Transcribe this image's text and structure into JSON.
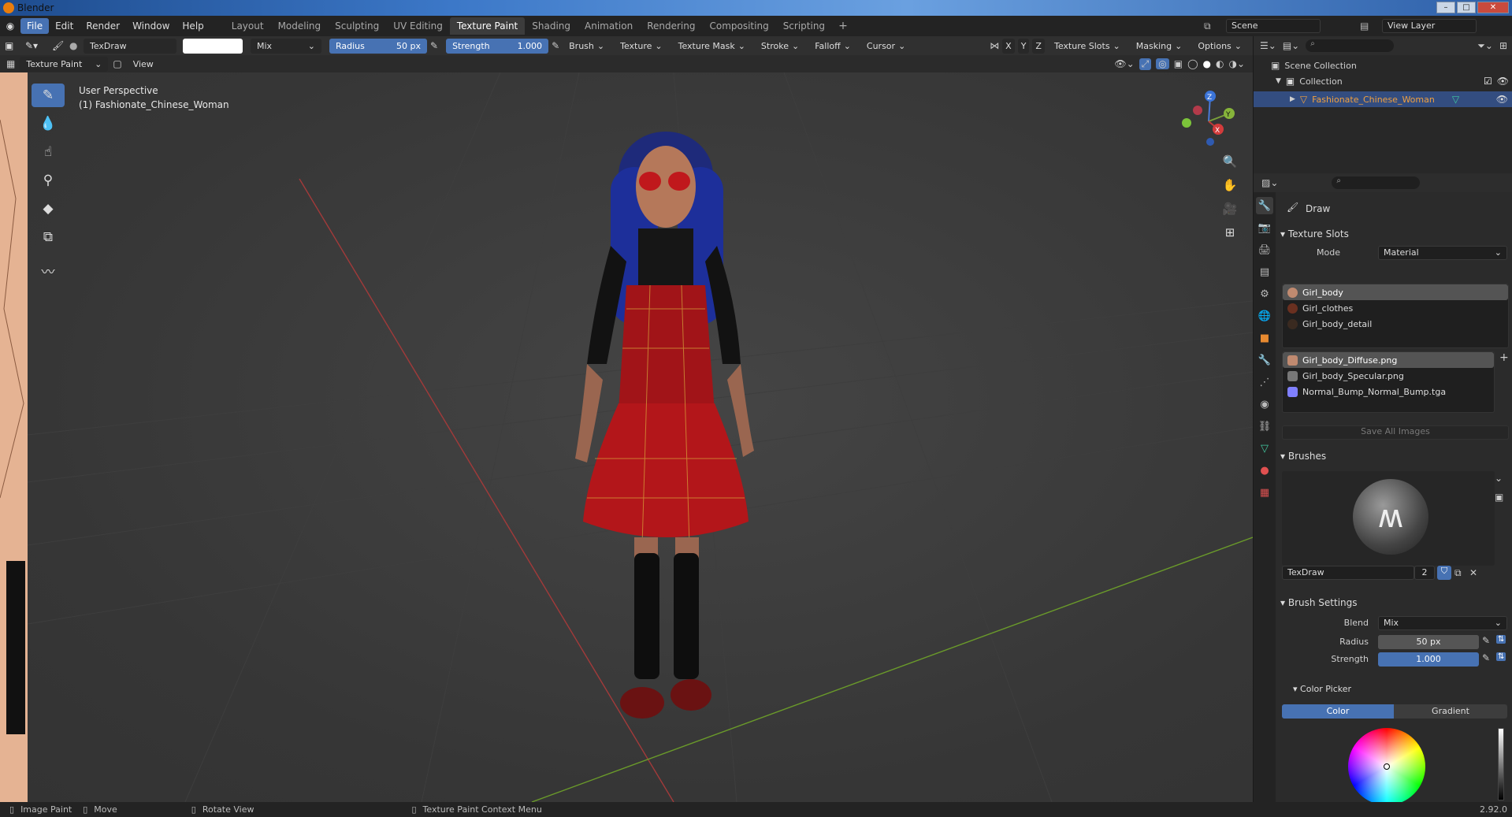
{
  "window": {
    "title": "Blender"
  },
  "menus": [
    "File",
    "Edit",
    "Render",
    "Window",
    "Help"
  ],
  "workspaces": [
    "Layout",
    "Modeling",
    "Sculpting",
    "UV Editing",
    "Texture Paint",
    "Shading",
    "Animation",
    "Rendering",
    "Compositing",
    "Scripting"
  ],
  "scene": {
    "scene_name": "Scene",
    "view_layer": "View Layer"
  },
  "tool_header": {
    "brush_name": "TexDraw",
    "blend": "Mix",
    "radius_label": "Radius",
    "radius_value": "50 px",
    "strength_label": "Strength",
    "strength_value": "1.000",
    "menus": [
      "Brush",
      "Texture",
      "Texture Mask",
      "Stroke",
      "Falloff",
      "Cursor"
    ],
    "axes": [
      "X",
      "Y",
      "Z"
    ],
    "right_menus": [
      "Texture Slots",
      "Masking",
      "Options"
    ]
  },
  "editor_header": {
    "mode": "Texture Paint",
    "view": "View"
  },
  "viewport": {
    "perspective": "User Perspective",
    "object": "(1) Fashionate_Chinese_Woman",
    "gizmo_axes": {
      "x": "X",
      "y": "Y",
      "z": "Z"
    }
  },
  "outliner": {
    "scene_collection": "Scene Collection",
    "collection": "Collection",
    "object": "Fashionate_Chinese_Woman"
  },
  "properties": {
    "tool_name": "Draw",
    "texture_slots": {
      "header": "Texture Slots",
      "mode_label": "Mode",
      "mode_value": "Material",
      "materials": [
        "Girl_body",
        "Girl_clothes",
        "Girl_body_detail"
      ],
      "images": [
        "Girl_body_Diffuse.png",
        "Girl_body_Specular.png",
        "Normal_Bump_Normal_Bump.tga"
      ],
      "save_all": "Save All Images"
    },
    "brushes": {
      "header": "Brushes",
      "name": "TexDraw",
      "users": "2"
    },
    "brush_settings": {
      "header": "Brush Settings",
      "blend_label": "Blend",
      "blend_value": "Mix",
      "radius_label": "Radius",
      "radius_value": "50 px",
      "strength_label": "Strength",
      "strength_value": "1.000"
    },
    "color_picker": {
      "header": "Color Picker",
      "tabs": [
        "Color",
        "Gradient"
      ]
    }
  },
  "statusbar": {
    "image_paint": "Image Paint",
    "move": "Move",
    "rotate": "Rotate View",
    "context": "Texture Paint Context Menu",
    "version": "2.92.0"
  },
  "colors": {
    "accent": "#4772b3",
    "brush_color": "#ffffff",
    "image_slot_purple": "#8080ff"
  }
}
